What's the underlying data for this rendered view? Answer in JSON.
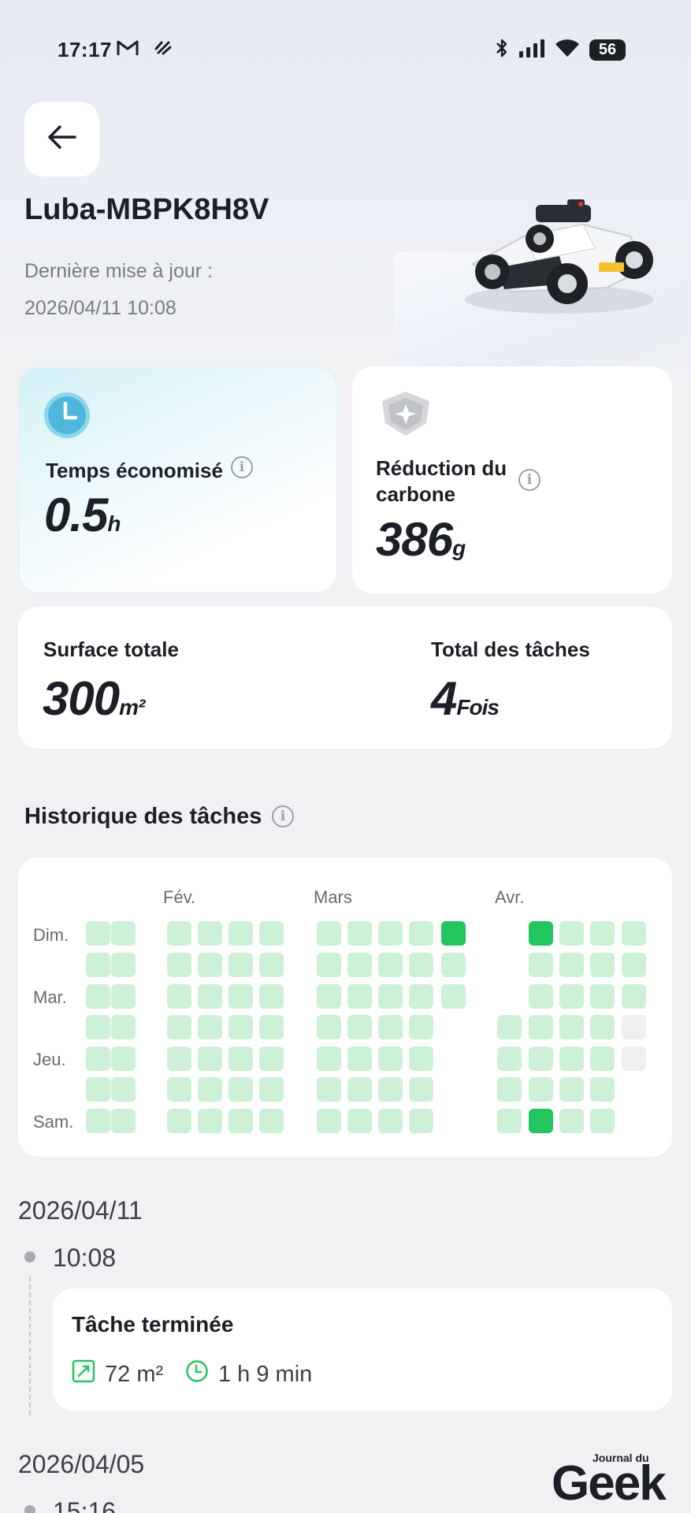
{
  "status_bar": {
    "time": "17:17",
    "notif_icons": [
      "gmail-icon",
      "app-notification-icon"
    ],
    "system_icons": [
      "bluetooth-icon",
      "signal-icon",
      "wifi-icon"
    ],
    "battery": "56"
  },
  "header": {
    "device_name": "Luba-MBPK8H8V",
    "update_label": "Dernière mise à jour :",
    "update_value": "2026/04/11 10:08"
  },
  "stats": {
    "time_saved": {
      "label": "Temps économisé",
      "value": "0.5",
      "unit": "h"
    },
    "carbon": {
      "label_line1": "Réduction du",
      "label_line2": "carbone",
      "value": "386",
      "unit": "g"
    },
    "surface": {
      "label": "Surface totale",
      "value": "300",
      "unit": "m²"
    },
    "tasks": {
      "label": "Total des tâches",
      "value": "4",
      "unit": "Fois"
    }
  },
  "history": {
    "title": "Historique des tâches",
    "months": [
      "Fév.",
      "Mars",
      "Avr."
    ],
    "day_labels": [
      "Dim.",
      "Mar.",
      "Jeu.",
      "Sam."
    ],
    "active_color": "#22c55e",
    "inactive_color": "#cdf1d6"
  },
  "timeline": [
    {
      "date": "2026/04/11",
      "time": "10:08",
      "task_title": "Tâche terminée",
      "area": "72 m²",
      "duration": "1 h 9 min"
    },
    {
      "date": "2026/04/05",
      "time": "15:16"
    }
  ],
  "watermark": {
    "small": "Journal du",
    "big": "Geek"
  }
}
